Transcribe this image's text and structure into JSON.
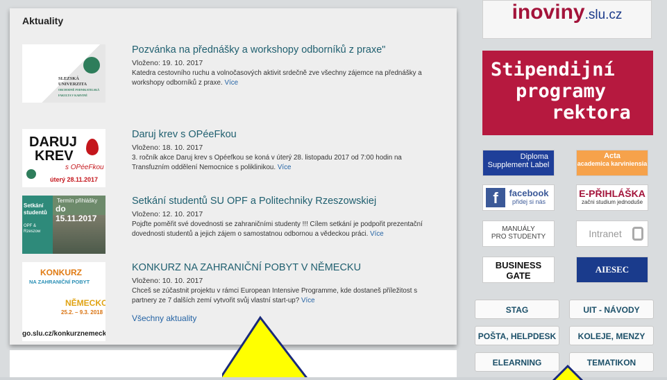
{
  "news": {
    "title": "Aktuality",
    "items": [
      {
        "heading": "Pozvánka na přednášky a workshopy odborníků z praxe\"",
        "date": "Vloženo: 19. 10. 2017",
        "text": "Katedra cestovního ruchu a volnočasových aktivit srdečně zve všechny zájemce na přednášky a workshopy odborníků z praxe.",
        "more": "Více",
        "thumb_lines": [
          "SLEZSKÁ",
          "UNIVERZITA",
          "OBCHODNĚ PODNIKATELSKÁ",
          "FAKULTA V KARVINÉ"
        ]
      },
      {
        "heading": "Daruj krev s OPéeFkou",
        "date": "Vloženo: 18. 10. 2017",
        "text": "3. ročník akce Daruj krev s Opéefkou se koná v úterý 28. listopadu 2017 od 7:00 hodin na Transfuzním oddělení Nemocnice s poliklinikou.",
        "more": "Více",
        "thumb_lines": [
          "DARUJ",
          "KREV",
          "s OPéeFkou",
          "úterý 28.11.2017"
        ]
      },
      {
        "heading": "Setkání studentů SU OPF a Politechniky Rzeszowskiej",
        "date": "Vloženo: 12. 10. 2017",
        "text": "Pojďte poměřit své dovednosti se zahraničními studenty !!! Cílem setkání je podpořit prezentační dovednosti studentů a jejich zájem o samostatnou odbornou a vědeckou práci.",
        "more": "Více",
        "thumb_lines": [
          "Setkání studentů",
          "OPF & Rzeszow",
          "Termín přihlášky",
          "do 15.11.2017"
        ]
      },
      {
        "heading": "KONKURZ NA ZAHRANIČNÍ POBYT V NĚMECKU",
        "date": "Vloženo: 10. 10. 2017",
        "text": "Chceš se zúčastnit projektu v rámci European Intensive Programme, kde dostaneš příležitost s partnery ze 7 dalších zemí vytvořit svůj vlastní start-up?",
        "more": "Více",
        "thumb_lines": [
          "KONKURZ",
          "NA ZAHRANIČNÍ POBYT",
          "NĚMECKO",
          "25.2. – 9.3. 2018",
          "go.slu.cz/konkurznemecko"
        ]
      }
    ],
    "all_link": "Všechny aktuality"
  },
  "sidebar": {
    "inoviny_big": "inoviny",
    "inoviny_small": ".slu.cz",
    "stipendia": [
      "Stipendijní",
      "programy",
      "rektora"
    ],
    "tiles": [
      {
        "line1": "Diploma",
        "line2": "Supplement Label"
      },
      {
        "line1": "Acta",
        "line2": "academica karviniensia"
      },
      {
        "line1": "facebook",
        "line2": "přidej si nás"
      },
      {
        "line1": "E-PŘIHLÁŠKA",
        "line2": "začni studium jednoduše"
      },
      {
        "line1": "MANUÁLY",
        "line2": "PRO STUDENTY"
      },
      {
        "line1": "Intranet",
        "line2": ""
      },
      {
        "line1": "BUSINESS",
        "line2": "GATE"
      },
      {
        "line1": "AIESEC",
        "line2": ""
      }
    ],
    "buttons": [
      "STAG",
      "UIT - NÁVODY",
      "POŠTA, HELPDESK",
      "KOLEJE, MENZY",
      "ELEARNING",
      "TEMATIKON"
    ]
  },
  "colors": {
    "accent": "#a3133a",
    "link": "#2463a4",
    "heading": "#1f5f6f",
    "arrow": "#ffff00"
  }
}
